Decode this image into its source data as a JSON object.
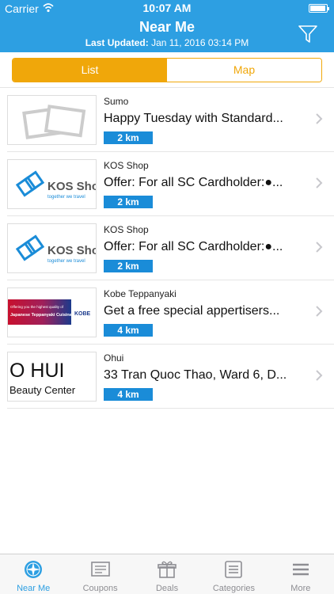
{
  "status": {
    "carrier": "Carrier",
    "time": "10:07 AM"
  },
  "header": {
    "title": "Near Me",
    "updated_label": "Last Updated:",
    "updated_value": "Jan 11, 2016 03:14 PM"
  },
  "segments": {
    "list": "List",
    "map": "Map",
    "selected": "List"
  },
  "items": [
    {
      "merchant": "Sumo",
      "offer": "Happy Tuesday with Standard...",
      "distance": "2 km",
      "image": "placeholder-image-icon"
    },
    {
      "merchant": "KOS Shop",
      "offer": "Offer: For all SC Cardholder:●...",
      "distance": "2 km",
      "image": "kos-shop-logo",
      "logo_text": "KOS Shop.vn",
      "logo_tagline": "together we travel"
    },
    {
      "merchant": "KOS Shop",
      "offer": "Offer: For all SC Cardholder:●...",
      "distance": "2 km",
      "image": "kos-shop-logo",
      "logo_text": "KOS Shop.vn",
      "logo_tagline": "together we travel"
    },
    {
      "merchant": "Kobe Teppanyaki",
      "offer": "Get a free special appertisers...",
      "distance": "4 km",
      "image": "kobe-banner",
      "banner_line1": "Offering you the highest quality of",
      "banner_line2": "Japanese Teppanyaki Cuisine",
      "banner_brand": "KOBE"
    },
    {
      "merchant": "Ohui",
      "offer": "33 Tran Quoc Thao, Ward 6, D...",
      "distance": "4 km",
      "image": "ohui-logo",
      "logo_line1": "O HUI",
      "logo_line2": "Beauty Center"
    }
  ],
  "tabs": [
    {
      "label": "Near Me",
      "icon": "compass-icon",
      "active": true
    },
    {
      "label": "Coupons",
      "icon": "coupon-icon",
      "active": false
    },
    {
      "label": "Deals",
      "icon": "gift-icon",
      "active": false
    },
    {
      "label": "Categories",
      "icon": "categories-icon",
      "active": false
    },
    {
      "label": "More",
      "icon": "menu-icon",
      "active": false
    }
  ],
  "colors": {
    "header": "#2d9fe2",
    "accent": "#f0a70a",
    "distance_badge": "#1a8cd8"
  }
}
